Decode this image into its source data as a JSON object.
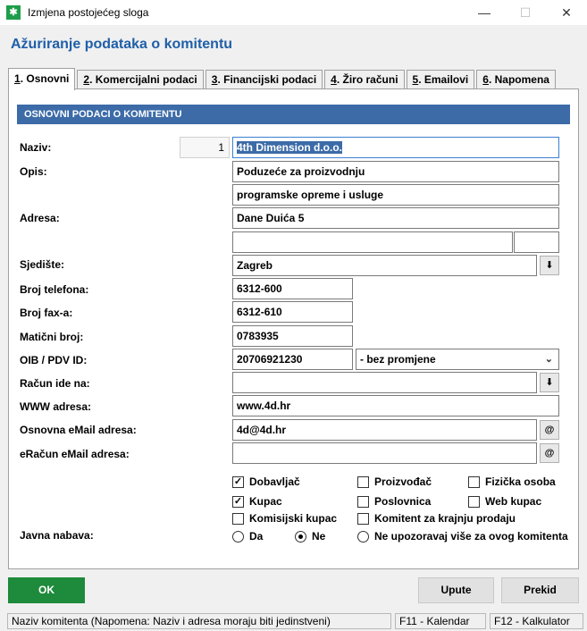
{
  "window": {
    "title": "Izmjena postojećeg sloga",
    "minimize": "—",
    "maximize": "☐",
    "close": "✕"
  },
  "heading": "Ažuriranje podataka o komitentu",
  "tabs": [
    {
      "key": "1",
      "label": ". Osnovni"
    },
    {
      "key": "2",
      "label": ". Komercijalni podaci"
    },
    {
      "key": "3",
      "label": ". Financijski podaci"
    },
    {
      "key": "4",
      "label": ". Žiro računi"
    },
    {
      "key": "5",
      "label": ". Emailovi"
    },
    {
      "key": "6",
      "label": ". Napomena"
    }
  ],
  "section_title": "OSNOVNI PODACI O KOMITENTU",
  "labels": {
    "naziv": "Naziv:",
    "opis": "Opis:",
    "adresa": "Adresa:",
    "sjediste": "Sjedište:",
    "telefon": "Broj telefona:",
    "fax": "Broj fax-a:",
    "maticni": "Matični broj:",
    "oib": "OIB / PDV ID:",
    "racun": "Račun ide na:",
    "www": "WWW adresa:",
    "email": "Osnovna eMail adresa:",
    "eracun": "eRačun eMail adresa:",
    "javna": "Javna nabava:"
  },
  "fields": {
    "id": "1",
    "naziv": "4th Dimension d.o.o.",
    "opis1": "Poduzeće za proizvodnju",
    "opis2": "programske opreme i usluge",
    "adresa1": "Dane Duića 5",
    "adresa2": "",
    "adresa3": "",
    "sjediste": "Zagreb",
    "telefon": "6312-600",
    "fax": "6312-610",
    "maticni": "0783935",
    "oib": "20706921230",
    "pdv_option": "- bez promjene",
    "racun": "",
    "www": "www.4d.hr",
    "email": "4d@4d.hr",
    "eracun": ""
  },
  "icons": {
    "dropdown": "download-arrow-icon",
    "at": "at-icon",
    "chevron": "chevron-down-icon"
  },
  "checkboxes": {
    "dobavljac": {
      "label": "Dobavljač",
      "checked": true
    },
    "proizvodac": {
      "label": "Proizvođač",
      "checked": false
    },
    "fizicka": {
      "label": "Fizička osoba",
      "checked": false
    },
    "kupac": {
      "label": "Kupac",
      "checked": true
    },
    "poslovnica": {
      "label": "Poslovnica",
      "checked": false
    },
    "web_kupac": {
      "label": "Web kupac",
      "checked": false
    },
    "komisijski": {
      "label": "Komisijski kupac",
      "checked": false
    },
    "krajnja": {
      "label": "Komitent za krajnju prodaju",
      "checked": false
    }
  },
  "radios": {
    "da": {
      "label": "Da",
      "selected": false
    },
    "ne": {
      "label": "Ne",
      "selected": true
    },
    "ne_upozoravaj": {
      "label": "Ne upozoravaj više za ovog komitenta",
      "selected": false
    }
  },
  "buttons": {
    "ok": "OK",
    "upute": "Upute",
    "prekid": "Prekid"
  },
  "status": {
    "hint": "Naziv komitenta (Napomena: Naziv i adresa moraju biti jedinstveni)",
    "f11": "F11 - Kalendar",
    "f12": "F12 - Kalkulator"
  },
  "colors": {
    "accent": "#3c6ba8",
    "heading": "#1f5fa8",
    "ok": "#1e8a3c"
  }
}
